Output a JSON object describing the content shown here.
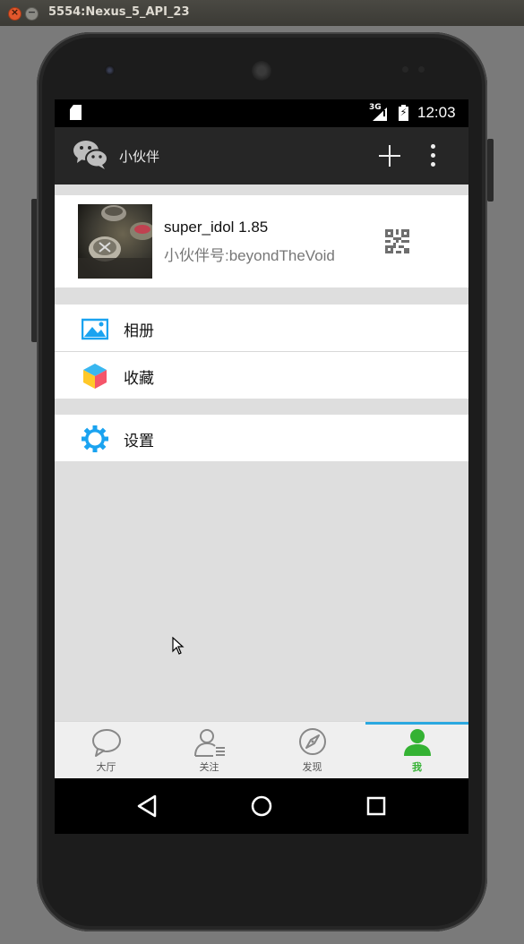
{
  "window": {
    "title": "5554:Nexus_5_API_23"
  },
  "statusbar": {
    "network": "3G",
    "time": "12:03"
  },
  "appbar": {
    "title": "小伙伴",
    "logo_icon": "wechat-icon",
    "add_icon": "plus-icon",
    "more_icon": "overflow-menu-icon"
  },
  "profile": {
    "name": "super_idol 1.85",
    "id": "小伙伴号:beyondTheVoid",
    "qr_icon": "qr-code-icon"
  },
  "menu": [
    {
      "label": "相册",
      "icon": "album-icon"
    },
    {
      "label": "收藏",
      "icon": "favorites-cube-icon"
    }
  ],
  "settings": {
    "label": "设置",
    "icon": "gear-icon"
  },
  "tabs": [
    {
      "label": "大厅",
      "icon": "chat-bubble-icon"
    },
    {
      "label": "关注",
      "icon": "contacts-icon"
    },
    {
      "label": "发现",
      "icon": "compass-icon"
    },
    {
      "label": "我",
      "icon": "person-icon"
    }
  ],
  "active_tab": "我",
  "colors": {
    "accent_green": "#34b233",
    "tab_indicator": "#2ba8e0",
    "icon_blue": "#1aa3f0"
  }
}
